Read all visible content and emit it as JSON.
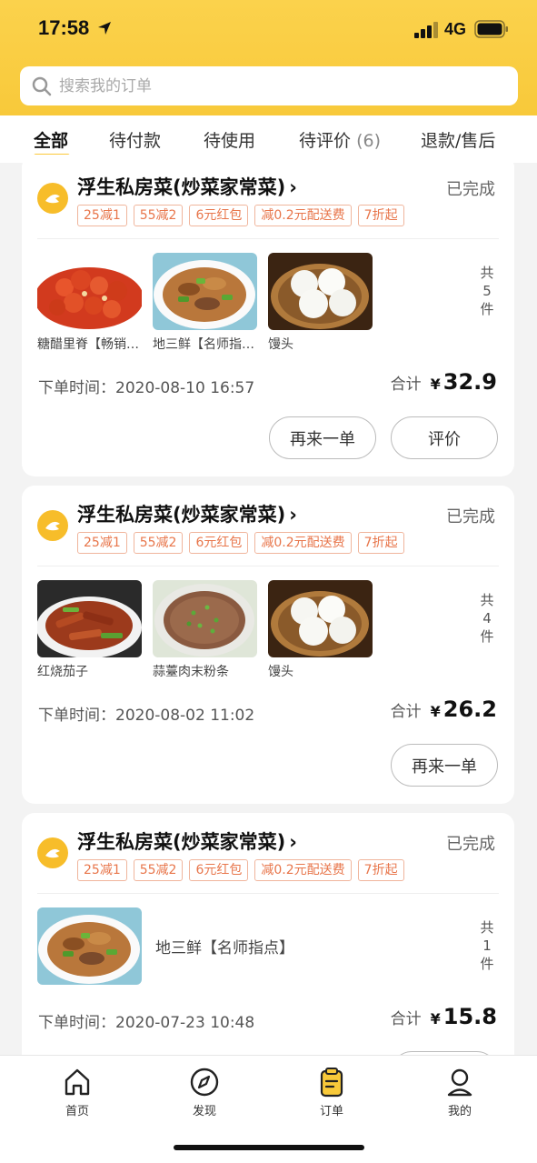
{
  "status_bar": {
    "time": "17:58",
    "network": "4G"
  },
  "search": {
    "placeholder": "搜索我的订单"
  },
  "tabs": [
    {
      "label": "全部",
      "count": ""
    },
    {
      "label": "待付款",
      "count": ""
    },
    {
      "label": "待使用",
      "count": ""
    },
    {
      "label": "待评价",
      "count": "(6)"
    },
    {
      "label": "退款/售后",
      "count": ""
    }
  ],
  "labels": {
    "order_time_prefix": "下单时间：",
    "total_label": "合计",
    "currency": "¥",
    "count_prefix": "共",
    "count_suffix": "件"
  },
  "orders": [
    {
      "shop": "浮生私房菜(炒菜家常菜)",
      "status": "已完成",
      "promos": [
        "25减1",
        "55减2",
        "6元红包",
        "减0.2元配送费",
        "7折起"
      ],
      "items": [
        {
          "name": "糖醋里脊【畅销推荐】",
          "image": "sweet-sour-pork"
        },
        {
          "name": "地三鲜【名师指点】",
          "image": "di-san-xian"
        },
        {
          "name": "馒头",
          "image": "steamed-buns"
        }
      ],
      "count": "5",
      "time": "2020-08-10 16:57",
      "total": "32.9",
      "buttons": [
        "再来一单",
        "评价"
      ]
    },
    {
      "shop": "浮生私房菜(炒菜家常菜)",
      "status": "已完成",
      "promos": [
        "25减1",
        "55减2",
        "6元红包",
        "减0.2元配送费",
        "7折起"
      ],
      "items": [
        {
          "name": "红烧茄子",
          "image": "braised-eggplant"
        },
        {
          "name": "蒜薹肉末粉条",
          "image": "pork-vermicelli"
        },
        {
          "name": "馒头",
          "image": "steamed-buns"
        }
      ],
      "count": "4",
      "time": "2020-08-02 11:02",
      "total": "26.2",
      "buttons": [
        "再来一单"
      ]
    },
    {
      "shop": "浮生私房菜(炒菜家常菜)",
      "status": "已完成",
      "promos": [
        "25减1",
        "55减2",
        "6元红包",
        "减0.2元配送费",
        "7折起"
      ],
      "items": [
        {
          "name": "地三鲜【名师指点】",
          "image": "di-san-xian"
        }
      ],
      "count": "1",
      "time": "2020-07-23 10:48",
      "total": "15.8",
      "buttons": []
    }
  ],
  "bottom_nav": [
    {
      "label": "首页",
      "icon": "home-icon",
      "active": false
    },
    {
      "label": "发现",
      "icon": "compass-icon",
      "active": false
    },
    {
      "label": "订单",
      "icon": "order-icon",
      "active": true
    },
    {
      "label": "我的",
      "icon": "profile-icon",
      "active": false
    }
  ],
  "colors": {
    "brand_yellow": "#f8c93a",
    "promo_orange": "#e8764b",
    "tab_indicator": "#fbc83a"
  }
}
